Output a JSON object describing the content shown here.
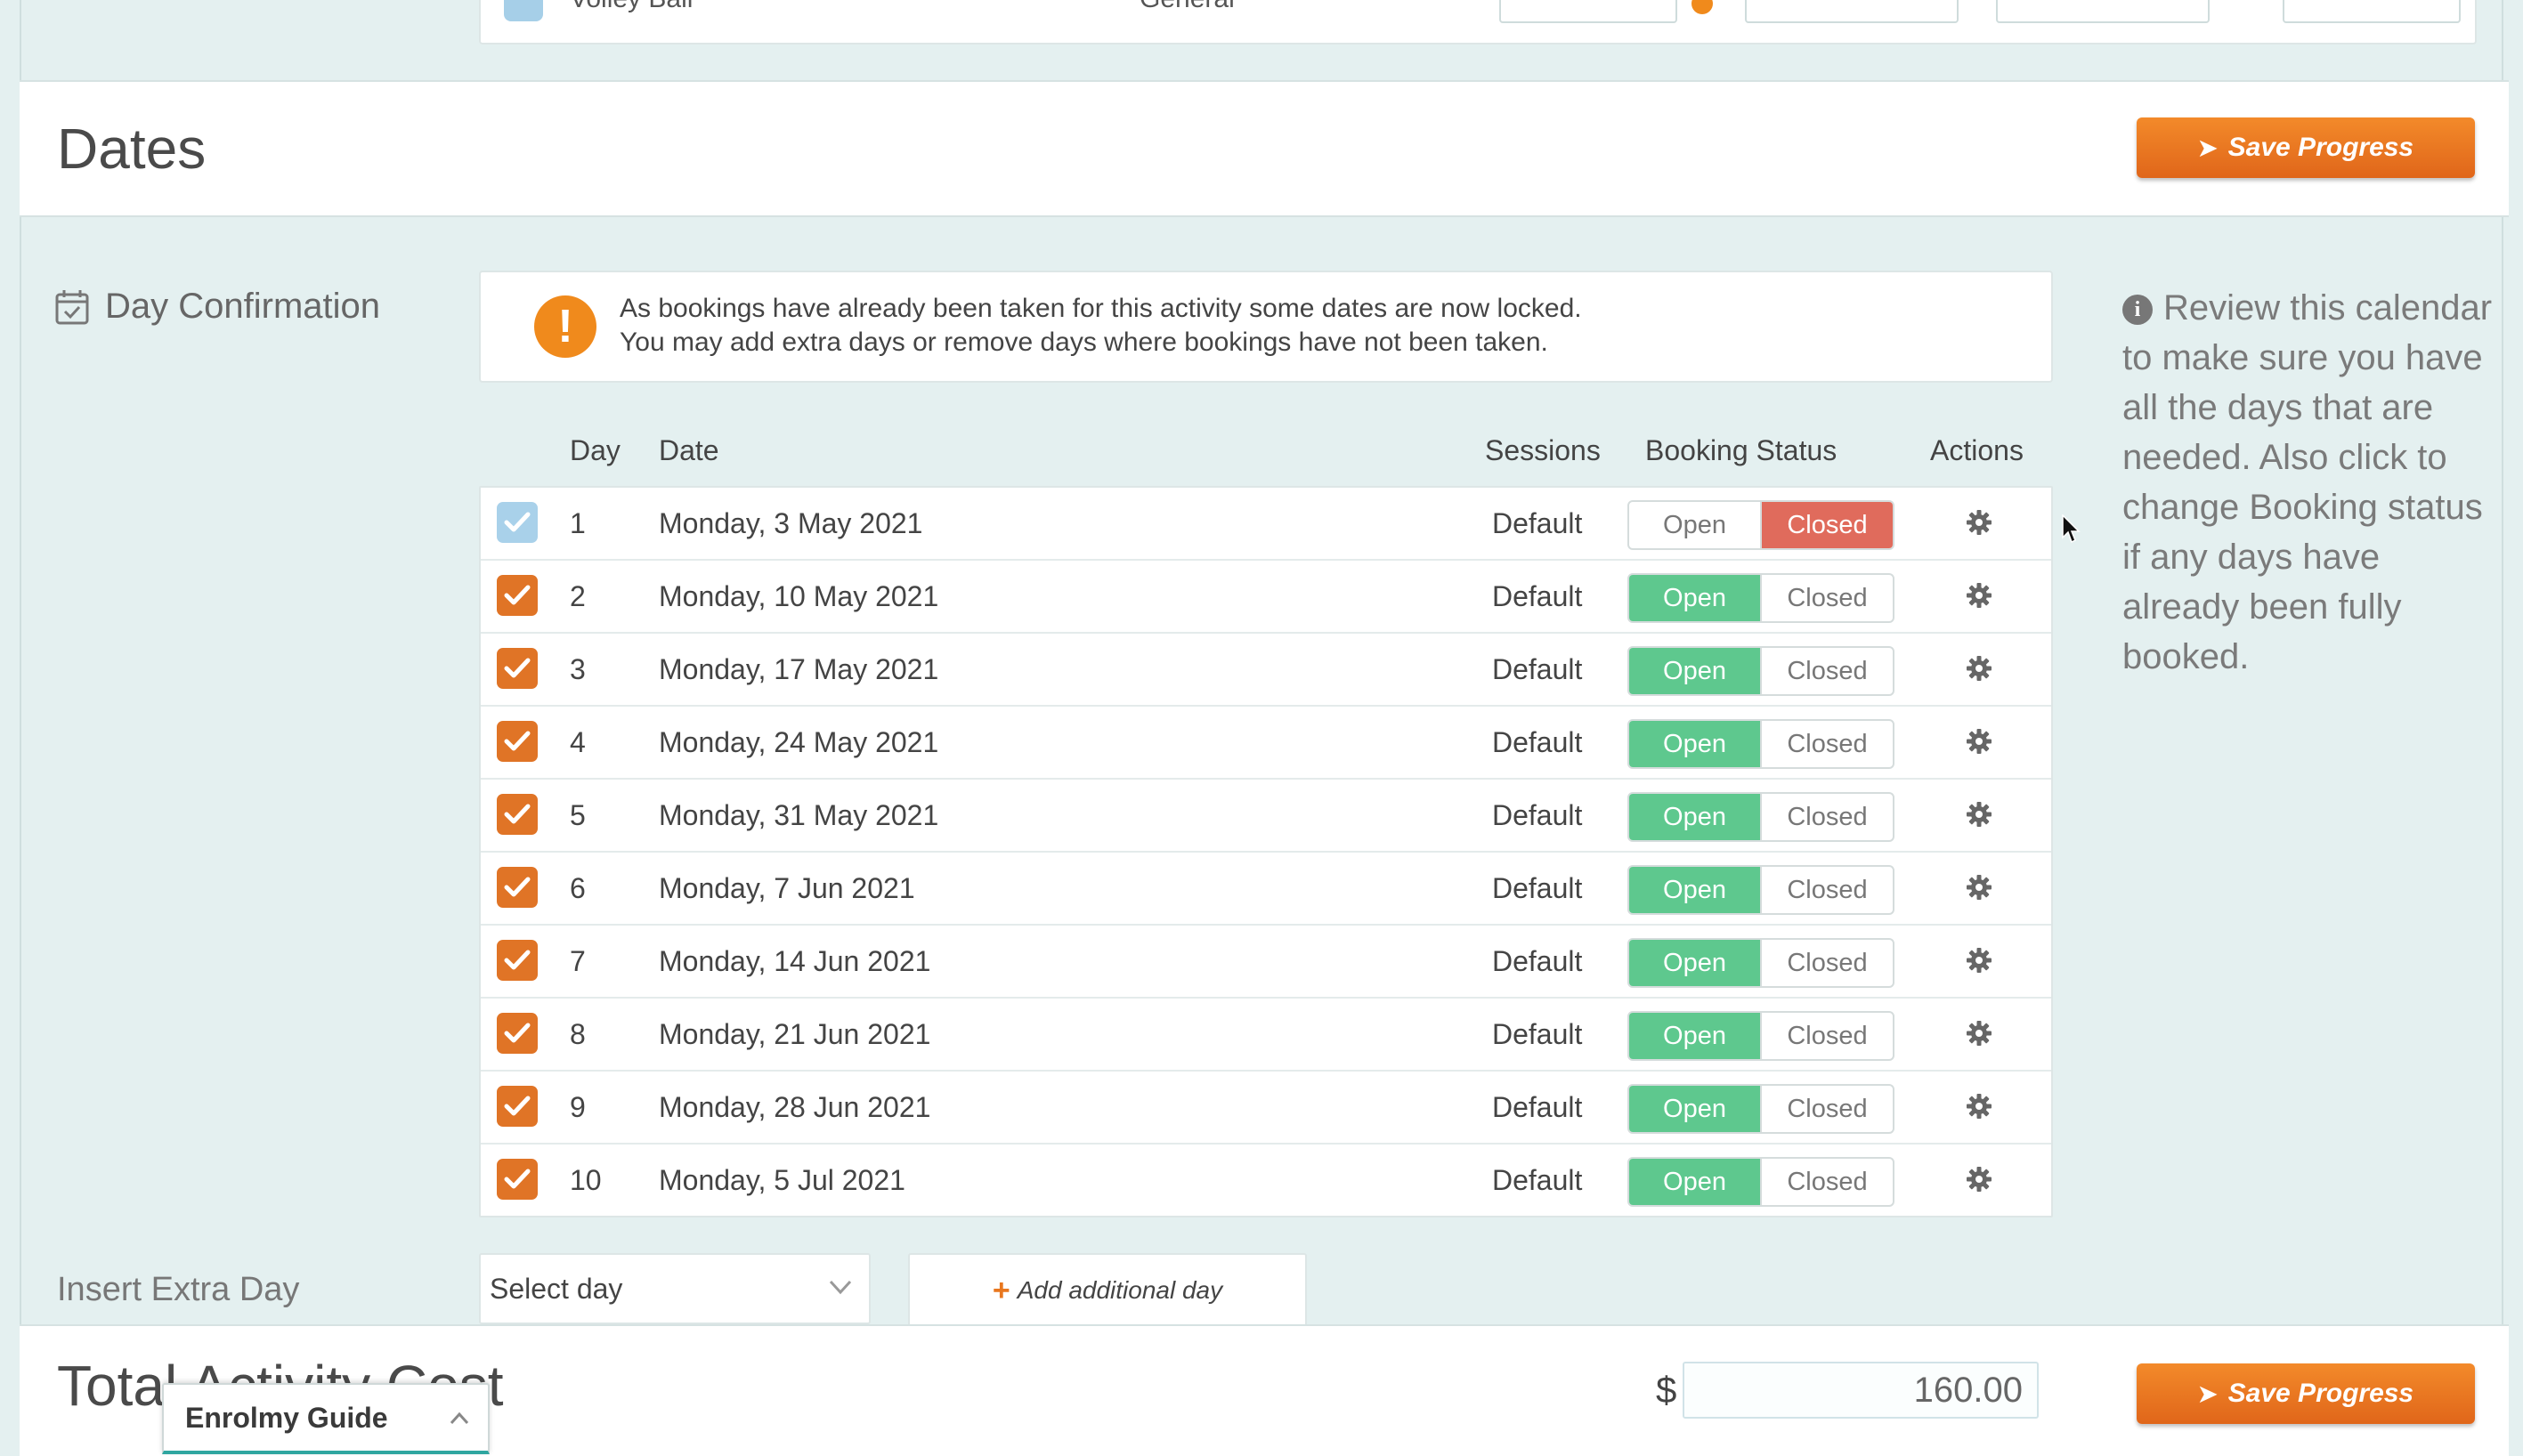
{
  "prev_row": {
    "activity": "Volley Ball",
    "type": "General"
  },
  "dates_header": {
    "title": "Dates",
    "save_label": "Save Progress"
  },
  "day_confirmation": {
    "label": "Day Confirmation",
    "alert_line1": "As bookings have already been taken for this activity some dates are now locked.",
    "alert_line2": "You may add extra days or remove days where bookings have not been taken.",
    "info_text": "Review this calendar to make sure you have all the days that are needed. Also click to change Booking status if any days have already been fully booked."
  },
  "table": {
    "headers": {
      "day": "Day",
      "date": "Date",
      "sessions": "Sessions",
      "status": "Booking Status",
      "actions": "Actions"
    },
    "open_label": "Open",
    "closed_label": "Closed",
    "rows": [
      {
        "day": "1",
        "date": "Monday, 3 May 2021",
        "sessions": "Default",
        "status": "closed",
        "locked": true
      },
      {
        "day": "2",
        "date": "Monday, 10 May 2021",
        "sessions": "Default",
        "status": "open",
        "locked": false
      },
      {
        "day": "3",
        "date": "Monday, 17 May 2021",
        "sessions": "Default",
        "status": "open",
        "locked": false
      },
      {
        "day": "4",
        "date": "Monday, 24 May 2021",
        "sessions": "Default",
        "status": "open",
        "locked": false
      },
      {
        "day": "5",
        "date": "Monday, 31 May 2021",
        "sessions": "Default",
        "status": "open",
        "locked": false
      },
      {
        "day": "6",
        "date": "Monday, 7 Jun 2021",
        "sessions": "Default",
        "status": "open",
        "locked": false
      },
      {
        "day": "7",
        "date": "Monday, 14 Jun 2021",
        "sessions": "Default",
        "status": "open",
        "locked": false
      },
      {
        "day": "8",
        "date": "Monday, 21 Jun 2021",
        "sessions": "Default",
        "status": "open",
        "locked": false
      },
      {
        "day": "9",
        "date": "Monday, 28 Jun 2021",
        "sessions": "Default",
        "status": "open",
        "locked": false
      },
      {
        "day": "10",
        "date": "Monday, 5 Jul 2021",
        "sessions": "Default",
        "status": "open",
        "locked": false
      }
    ]
  },
  "insert_extra": {
    "label": "Insert Extra Day",
    "select_value": "Select day",
    "add_label": "Add additional day"
  },
  "total": {
    "title": "Total Activity Cost",
    "currency": "$",
    "value": "160.00",
    "save_label": "Save Progress"
  },
  "guide": {
    "label": "Enrolmy Guide"
  },
  "colors": {
    "accent_orange": "#e8771f",
    "open_green": "#5ec88e",
    "closed_red": "#e06b5c",
    "locked_blue": "#a9d1ea",
    "background": "#e4f0f0"
  },
  "icons": [
    "calendar-check-icon",
    "warning-icon",
    "info-icon",
    "gear-icon",
    "chevron-down-icon",
    "chevron-up-icon",
    "plus-icon",
    "arrow-right-icon",
    "checkmark-icon"
  ]
}
